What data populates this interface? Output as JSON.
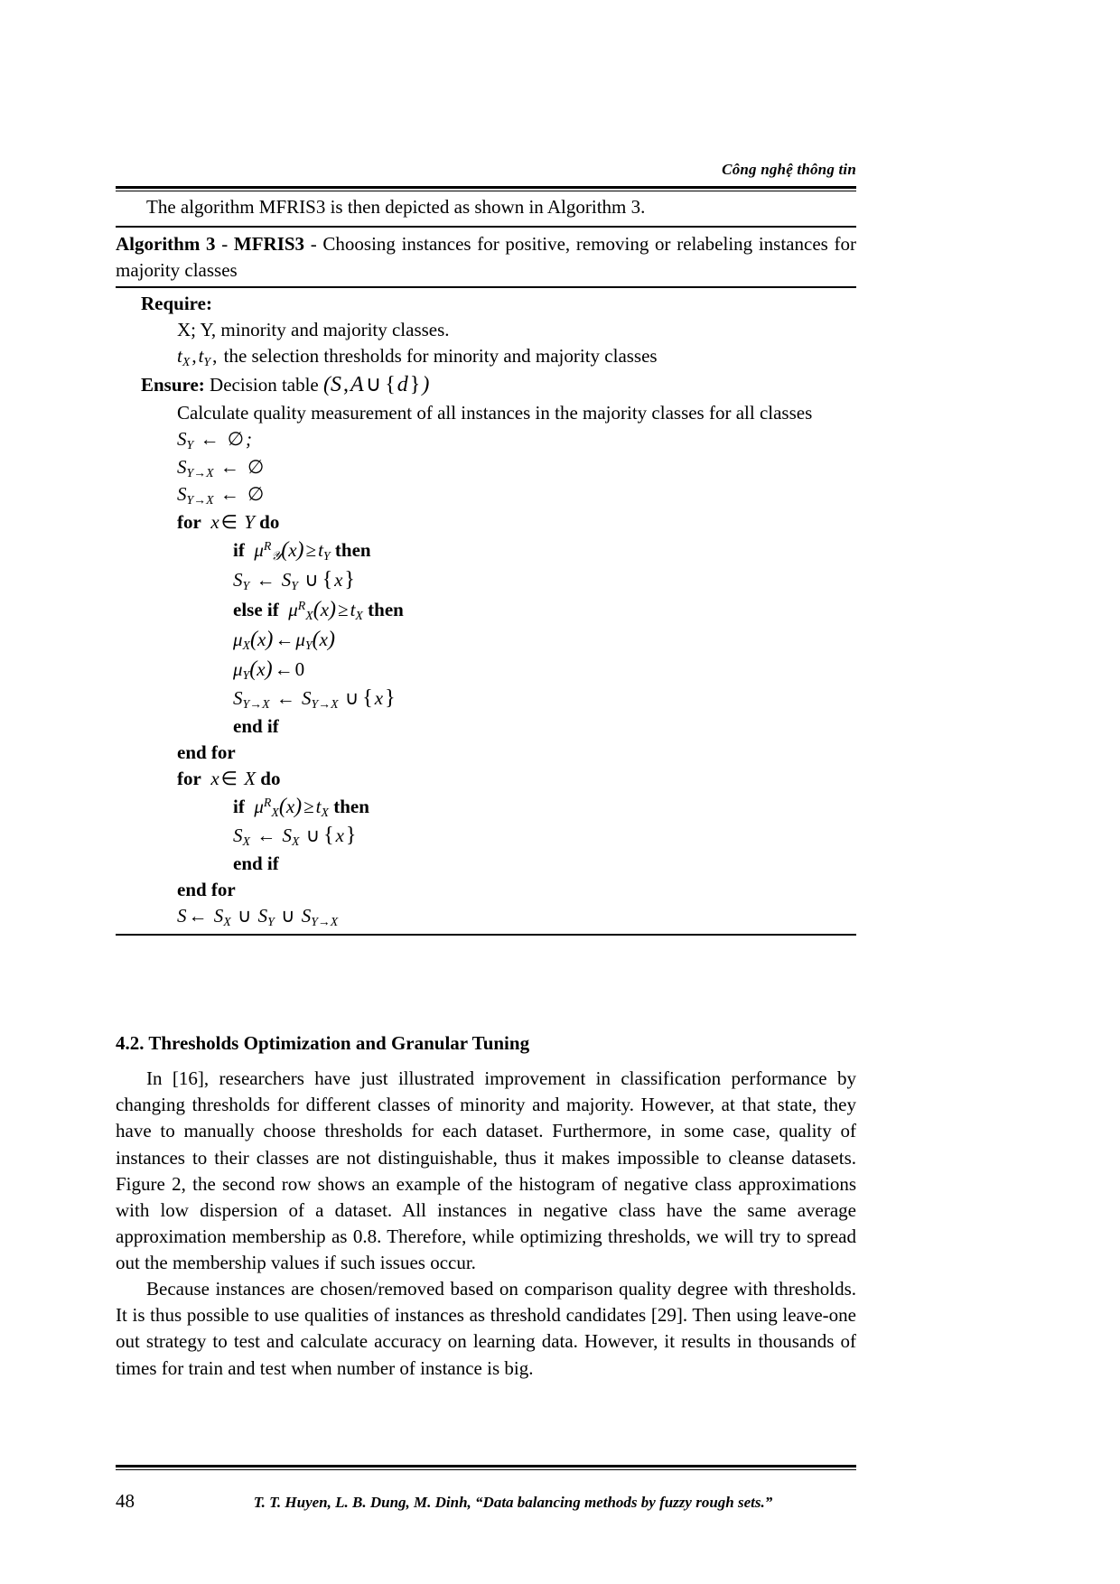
{
  "header": {
    "running_head": "Công nghệ thông tin"
  },
  "intro": {
    "text": "The algorithm MFRIS3 is then depicted as shown in Algorithm 3."
  },
  "algorithm": {
    "label": "Algorithm 3",
    "separator1": " - ",
    "name": "MFRIS3",
    "separator2": " - ",
    "description": "Choosing instances for positive, removing or relabeling instances for majority classes",
    "require_label": "Require:",
    "require_lines": [
      "X; Y, minority and majority classes.",
      "the selection thresholds for minority and majority classes"
    ],
    "require_math_prefix": "t_X , t_Y ,",
    "ensure_label": "Ensure:",
    "ensure_text": "Decision table",
    "ensure_math": "(S, A ∪ {d})",
    "steps": [
      "Calculate quality measurement of all instances in the majority classes for all classes",
      "S_Y ← ∅;",
      "S_{Y→X} ← ∅",
      "S_{Y→X} ← ∅",
      "for x ∈ Y do",
      "if μ^R_𝒴 (x) ≥ t_Y then",
      "S_Y ← S_Y ∪ {x}",
      "else if μ^R_X (x) ≥ t_X then",
      "μ_X (x) ← μ_Y (x)",
      "μ_Y (x) ← 0",
      "S_{Y→X} ← S_{Y→X} ∪ {x}",
      "end if",
      "end for",
      "for x ∈ X do",
      "if μ^R_X (x) ≥ t_X then",
      "S_X ← S_X ∪ {x}",
      "end if",
      "end for",
      "S ← S_X ∪ S_Y ∪ S_{Y→X}"
    ],
    "keywords": {
      "for": "for",
      "do": "do",
      "if": "if",
      "then": "then",
      "else_if": "else if",
      "end_if": "end if",
      "end_for": "end for"
    }
  },
  "section": {
    "heading": "4.2. Thresholds Optimization and Granular Tuning",
    "paragraph_1": "In [16], researchers have just illustrated improvement in classification performance by changing thresholds for different classes of minority and majority. However, at that state, they have to manually choose thresholds for each dataset. Furthermore, in some case, quality of instances to their classes are not distinguishable, thus it makes impossible to cleanse datasets. Figure 2, the second row shows an example of the histogram of negative class approximations with low dispersion of a dataset. All instances in negative class have the same average approximation membership as 0.8. Therefore, while optimizing thresholds, we will try to spread out the membership values if such issues occur.",
    "paragraph_2": "Because instances are chosen/removed based on comparison quality degree with thresholds. It is thus possible to use qualities of instances as threshold candidates [29]. Then using leave-one out strategy to test and calculate accuracy on learning data. However, it results in thousands of times for train and test when number of instance is big."
  },
  "footer": {
    "page_number": "48",
    "citation": "T. T. Huyen, L. B. Dung, M. Dinh, “Data balancing methods by fuzzy rough sets.”"
  }
}
